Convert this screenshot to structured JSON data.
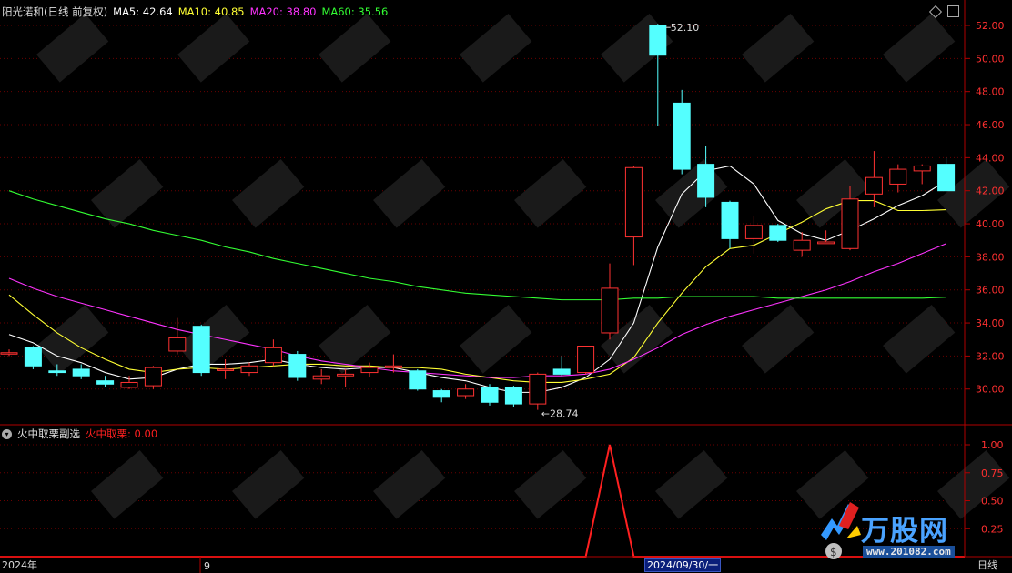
{
  "header": {
    "stock_title": "阳光诺和(日线 前复权)",
    "ma5_label": "MA5: 42.64",
    "ma10_label": "MA10: 40.85",
    "ma20_label": "MA20: 38.80",
    "ma60_label": "MA60: 35.56",
    "colors": {
      "ma5": "#ffffff",
      "ma10": "#ffff33",
      "ma20": "#ff33ff",
      "ma60": "#33ff33"
    }
  },
  "sub_header": {
    "indicator_name": "火中取栗副选",
    "indicator_value": "火中取栗: 0.00"
  },
  "x_axis": {
    "start_label": "2024年",
    "month_label": "9",
    "selected_date": "2024/09/30/一",
    "period_label": "日线"
  },
  "annotations": {
    "high_label": "52.10",
    "low_label": "28.74"
  },
  "logo": {
    "text": "万股网",
    "url": "www.201082.com"
  },
  "chart_data": [
    {
      "type": "candlestick",
      "ylim": [
        28.5,
        52.5
      ],
      "yticks": [
        "30.00",
        "32.00",
        "34.00",
        "36.00",
        "38.00",
        "40.00",
        "42.00",
        "44.00",
        "46.00",
        "48.00",
        "50.00",
        "52.00"
      ],
      "candles": [
        {
          "o": 32.2,
          "c": 32.2,
          "h": 32.4,
          "l": 32.0
        },
        {
          "o": 32.5,
          "c": 31.4,
          "h": 32.6,
          "l": 31.2
        },
        {
          "o": 31.1,
          "c": 31.0,
          "h": 31.5,
          "l": 30.8
        },
        {
          "o": 31.2,
          "c": 30.8,
          "h": 31.5,
          "l": 30.6
        },
        {
          "o": 30.5,
          "c": 30.3,
          "h": 30.8,
          "l": 30.1
        },
        {
          "o": 30.1,
          "c": 30.4,
          "h": 30.8,
          "l": 30.0
        },
        {
          "o": 30.2,
          "c": 31.3,
          "h": 31.4,
          "l": 30.0
        },
        {
          "o": 32.3,
          "c": 33.1,
          "h": 34.3,
          "l": 32.1
        },
        {
          "o": 33.8,
          "c": 31.0,
          "h": 33.9,
          "l": 30.8
        },
        {
          "o": 31.2,
          "c": 31.2,
          "h": 31.8,
          "l": 30.6
        },
        {
          "o": 31.0,
          "c": 31.4,
          "h": 31.6,
          "l": 30.8
        },
        {
          "o": 31.6,
          "c": 32.5,
          "h": 33.0,
          "l": 31.4
        },
        {
          "o": 32.1,
          "c": 30.7,
          "h": 32.3,
          "l": 30.5
        },
        {
          "o": 30.6,
          "c": 30.8,
          "h": 31.2,
          "l": 30.3
        },
        {
          "o": 30.8,
          "c": 30.9,
          "h": 31.2,
          "l": 30.1
        },
        {
          "o": 31.0,
          "c": 31.3,
          "h": 31.6,
          "l": 30.7
        },
        {
          "o": 31.3,
          "c": 31.4,
          "h": 32.1,
          "l": 31.0
        },
        {
          "o": 31.1,
          "c": 30.0,
          "h": 31.2,
          "l": 29.9
        },
        {
          "o": 29.9,
          "c": 29.5,
          "h": 30.0,
          "l": 29.2
        },
        {
          "o": 29.6,
          "c": 30.0,
          "h": 30.3,
          "l": 29.4
        },
        {
          "o": 30.1,
          "c": 29.2,
          "h": 30.3,
          "l": 29.0
        },
        {
          "o": 30.1,
          "c": 29.1,
          "h": 30.2,
          "l": 28.9
        },
        {
          "o": 29.1,
          "c": 30.9,
          "h": 31.0,
          "l": 28.74
        },
        {
          "o": 31.2,
          "c": 30.9,
          "h": 32.0,
          "l": 30.8
        },
        {
          "o": 31.0,
          "c": 32.6,
          "h": 32.6,
          "l": 30.9
        },
        {
          "o": 33.4,
          "c": 36.1,
          "h": 37.6,
          "l": 33.0
        },
        {
          "o": 39.2,
          "c": 43.4,
          "h": 43.5,
          "l": 37.5
        },
        {
          "o": 52.0,
          "c": 50.2,
          "h": 52.1,
          "l": 45.9
        },
        {
          "o": 47.3,
          "c": 43.3,
          "h": 48.1,
          "l": 43.0
        },
        {
          "o": 43.6,
          "c": 41.6,
          "h": 44.7,
          "l": 41.0
        },
        {
          "o": 41.3,
          "c": 39.1,
          "h": 41.4,
          "l": 38.5
        },
        {
          "o": 39.1,
          "c": 39.9,
          "h": 40.5,
          "l": 38.2
        },
        {
          "o": 39.9,
          "c": 39.0,
          "h": 40.0,
          "l": 38.9
        },
        {
          "o": 38.4,
          "c": 39.0,
          "h": 39.5,
          "l": 38.0
        },
        {
          "o": 38.8,
          "c": 38.9,
          "h": 39.6,
          "l": 38.8
        },
        {
          "o": 38.5,
          "c": 41.5,
          "h": 42.3,
          "l": 38.4
        },
        {
          "o": 41.8,
          "c": 42.8,
          "h": 44.4,
          "l": 41.0
        },
        {
          "o": 42.4,
          "c": 43.3,
          "h": 43.6,
          "l": 41.9
        },
        {
          "o": 43.2,
          "c": 43.5,
          "h": 43.6,
          "l": 42.4
        },
        {
          "o": 43.6,
          "c": 42.0,
          "h": 44.0,
          "l": 42.0
        }
      ],
      "ma_series": [
        {
          "name": "MA5",
          "values": [
            33.3,
            32.8,
            32.0,
            31.6,
            31.0,
            30.6,
            30.7,
            31.2,
            31.5,
            31.5,
            31.6,
            31.8,
            31.5,
            31.3,
            31.2,
            31.3,
            31.3,
            31.0,
            30.7,
            30.5,
            30.1,
            29.8,
            29.8,
            30.1,
            30.7,
            31.8,
            34.0,
            38.6,
            41.8,
            43.2,
            43.5,
            42.4,
            40.2,
            39.4,
            39.0,
            39.6,
            40.3,
            41.1,
            41.7,
            42.6
          ]
        },
        {
          "name": "MA10",
          "values": [
            35.7,
            34.5,
            33.4,
            32.5,
            31.8,
            31.2,
            31.0,
            31.2,
            31.3,
            31.2,
            31.3,
            31.4,
            31.5,
            31.5,
            31.4,
            31.4,
            31.3,
            31.3,
            31.2,
            30.9,
            30.7,
            30.5,
            30.4,
            30.4,
            30.6,
            30.9,
            31.9,
            34.0,
            35.8,
            37.4,
            38.5,
            38.7,
            39.4,
            40.1,
            40.9,
            41.4,
            41.4,
            40.8,
            40.8,
            40.85
          ]
        },
        {
          "name": "MA20",
          "values": [
            36.7,
            36.1,
            35.6,
            35.2,
            34.8,
            34.4,
            34.0,
            33.6,
            33.3,
            33.0,
            32.7,
            32.4,
            32.0,
            31.7,
            31.5,
            31.3,
            31.1,
            31.0,
            30.9,
            30.8,
            30.7,
            30.7,
            30.8,
            30.8,
            30.9,
            31.2,
            31.8,
            32.5,
            33.3,
            33.9,
            34.4,
            34.8,
            35.2,
            35.6,
            36.0,
            36.5,
            37.1,
            37.6,
            38.2,
            38.8
          ]
        },
        {
          "name": "MA60",
          "values": [
            42.0,
            41.5,
            41.1,
            40.7,
            40.3,
            40.0,
            39.6,
            39.3,
            39.0,
            38.6,
            38.3,
            37.9,
            37.6,
            37.3,
            37.0,
            36.7,
            36.5,
            36.2,
            36.0,
            35.8,
            35.7,
            35.6,
            35.5,
            35.4,
            35.4,
            35.4,
            35.5,
            35.5,
            35.6,
            35.6,
            35.6,
            35.6,
            35.5,
            35.5,
            35.5,
            35.5,
            35.5,
            35.5,
            35.5,
            35.56
          ]
        }
      ]
    },
    {
      "type": "line",
      "name": "火中取栗",
      "ylim": [
        0,
        1.0
      ],
      "yticks": [
        "0.25",
        "0.50",
        "0.75",
        "1.00"
      ],
      "values": [
        0,
        0,
        0,
        0,
        0,
        0,
        0,
        0,
        0,
        0,
        0,
        0,
        0,
        0,
        0,
        0,
        0,
        0,
        0,
        0,
        0,
        0,
        0,
        0,
        0,
        1,
        0,
        0,
        0,
        0,
        0,
        0,
        0,
        0,
        0,
        0,
        0,
        0,
        0,
        0
      ]
    }
  ]
}
